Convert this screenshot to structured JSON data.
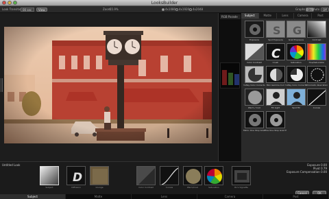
{
  "window": {
    "title": "LooksBuilder"
  },
  "toolbar": {
    "look_transition_label": "Look Transition",
    "look_transition_value": "00 sec",
    "view_button": "View",
    "zoom_label": "Zoom",
    "zoom_value": "55.9%",
    "res_options": [
      "4x1080",
      "4x1920",
      "4x2048"
    ],
    "res_selected": 0,
    "graphs_label": "Graphs",
    "graphs_seg": [
      "On",
      "Off"
    ],
    "auto_label": "Auto",
    "auto_seg": [
      "On",
      "Off"
    ]
  },
  "scopes": {
    "title": "RGB Parade"
  },
  "panel": {
    "tabs": [
      "Subject",
      "Matte",
      "Lens",
      "Camera",
      "Post"
    ],
    "active_tab": 0,
    "tools": [
      {
        "label": "Exposure",
        "icon": "exposure-icon"
      },
      {
        "label": "Spot Exposure",
        "icon": "spot-exposure-icon"
      },
      {
        "label": "Grad Exposure",
        "icon": "grad-exposure-icon"
      },
      {
        "label": "Contrast",
        "icon": "contrast-icon"
      },
      {
        "label": "Color Contrast",
        "icon": "color-contrast-icon"
      },
      {
        "label": "Crush",
        "icon": "crush-icon"
      },
      {
        "label": "Saturation",
        "icon": "saturation-icon"
      },
      {
        "label": "Hue/Saturation",
        "icon": "hue-saturation-icon"
      },
      {
        "label": "3-Way Color Corrector",
        "icon": "three-way-color-icon"
      },
      {
        "label": "Mini Gamma Corr",
        "icon": "mini-gamma-icon"
      },
      {
        "label": "3-Way Color Corrector",
        "icon": "three-way-color-icon-2"
      },
      {
        "label": "Chromatic Aberration",
        "icon": "chromatic-aberration-icon"
      },
      {
        "label": "Warm / Cool",
        "icon": "warm-cool-icon"
      },
      {
        "label": "Fill Light",
        "icon": "fill-light-icon"
      },
      {
        "label": "Spot Fill",
        "icon": "spot-fill-icon"
      },
      {
        "label": "Curves",
        "icon": "curves-icon"
      },
      {
        "label": "Mimic One Stop Grad Exposure",
        "icon": "minus-one-stop-icon"
      },
      {
        "label": "Plus One Stop Grad Exposure",
        "icon": "plus-one-stop-icon"
      }
    ]
  },
  "stack": {
    "look_name": "Untitled Look",
    "layers": [
      {
        "label": "Subject",
        "icon": "subject-layer-icon",
        "selected": true
      },
      {
        "label": "Diffusion",
        "icon": "diffusion-layer-icon",
        "selected": false
      },
      {
        "label": "Grunge",
        "icon": "grunge-layer-icon",
        "selected": false
      },
      {
        "label": "Color Contrast",
        "icon": "color-contrast-layer-icon",
        "selected": false
      },
      {
        "label": "Curves",
        "icon": "curves-layer-icon",
        "selected": false
      },
      {
        "label": "Warm/Cool",
        "icon": "warm-cool-layer-icon",
        "selected": false
      },
      {
        "label": "Saturation",
        "icon": "saturation-layer-icon",
        "selected": false
      },
      {
        "label": "Ro's Vignette",
        "icon": "vignette-layer-icon",
        "selected": false
      }
    ],
    "readouts": [
      {
        "label": "Exposure",
        "value": "0.00"
      },
      {
        "label": "Pivot",
        "value": "0.79"
      },
      {
        "label": "Exposure Compensation",
        "value": "0.00"
      }
    ],
    "cancel": "Cancel",
    "ok": "OK"
  },
  "groups": {
    "items": [
      "Subject",
      "Matte",
      "Lens",
      "Camera",
      "Post"
    ],
    "active": 0
  },
  "colors": {
    "accent": "#d9d9d9",
    "photo_tint": "#c96b4a"
  }
}
